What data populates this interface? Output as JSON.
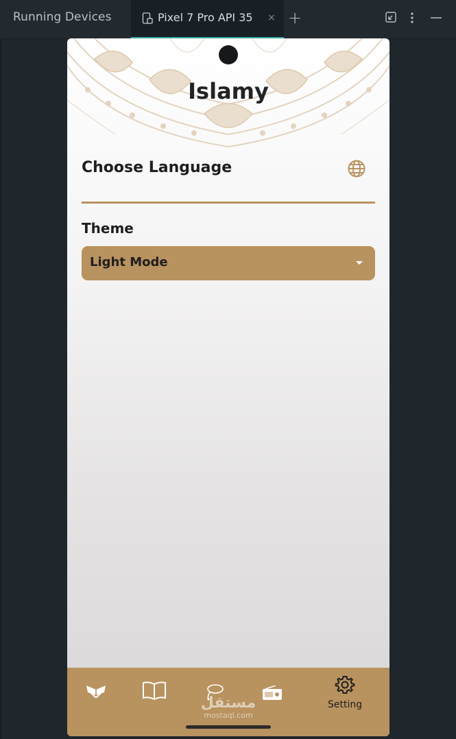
{
  "ide": {
    "title": "Running Devices",
    "tab_label": "Pixel 7 Pro API 35",
    "tab_close": "×",
    "add": "+"
  },
  "app": {
    "title": "Islamy",
    "language_label": "Choose Language",
    "theme_label": "Theme",
    "theme_value": "Light Mode"
  },
  "bottom_nav": {
    "items": [
      {
        "icon": "quran-icon",
        "label": ""
      },
      {
        "icon": "book-icon",
        "label": ""
      },
      {
        "icon": "tasbeh-icon",
        "label": ""
      },
      {
        "icon": "radio-icon",
        "label": ""
      },
      {
        "icon": "gear-icon",
        "label": "Setting"
      }
    ]
  },
  "watermark": {
    "arabic": "مستقل",
    "latin": "mostaql.com"
  },
  "colors": {
    "accent": "#b8925f",
    "ide_background": "#1f262c",
    "tab_underline": "#3ba89d"
  }
}
